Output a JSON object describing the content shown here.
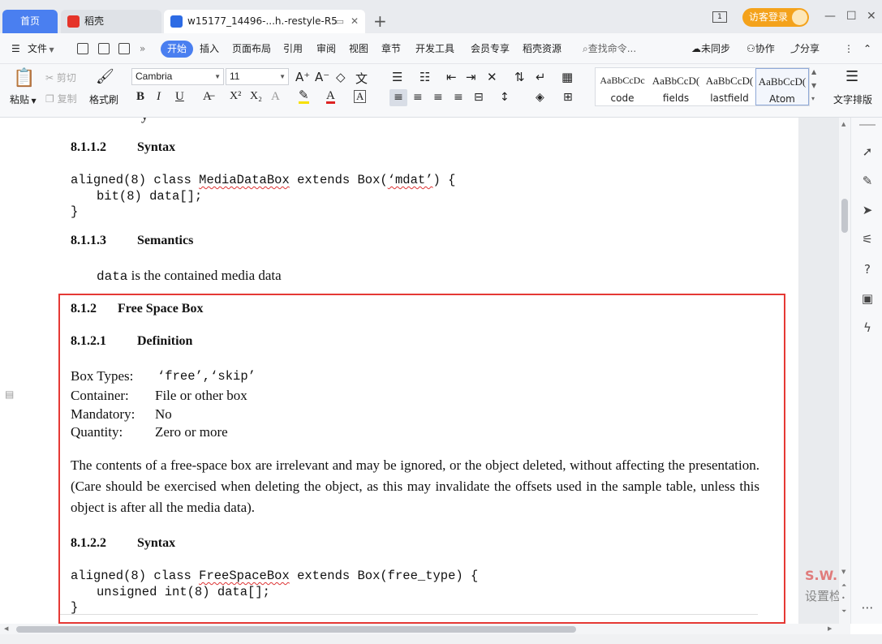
{
  "tabs": {
    "home": "首页",
    "wps": "稻壳",
    "doc": "w15177_14496-...h.-restyle-R5"
  },
  "header": {
    "visitor_login": "访客登录",
    "page_count_icon": "1"
  },
  "menu": {
    "file": "文件",
    "items": [
      "开始",
      "插入",
      "页面布局",
      "引用",
      "审阅",
      "视图",
      "章节",
      "开发工具",
      "会员专享",
      "稻壳资源"
    ],
    "search": "查找命令...",
    "unsync": "未同步",
    "collab": "协作",
    "share": "分享"
  },
  "ribbon": {
    "paste": "粘贴",
    "cut": "剪切",
    "copy": "复制",
    "format_painter": "格式刷",
    "font_name": "Cambria",
    "font_size": "11",
    "text_layout": "文字排版",
    "styles": [
      {
        "sample": "AaBbCcDc",
        "name": "code"
      },
      {
        "sample": "AaBbCcD(",
        "name": "fields"
      },
      {
        "sample": "AaBbCcD(",
        "name": "lastfield"
      },
      {
        "sample": "AaBbCcD(",
        "name": "Atom"
      }
    ]
  },
  "document": {
    "h_8112": {
      "num": "8.1.1.2",
      "title": "Syntax"
    },
    "code1": {
      "line1a": "aligned(8) class ",
      "line1b": "MediaDataBox",
      "line1c": " extends Box(",
      "line1d": "‘mdat’",
      "line1e": ") {",
      "line2": "bit(8) data[];",
      "line3": "}"
    },
    "h_8113": {
      "num": "8.1.1.3",
      "title": "Semantics"
    },
    "semantics": {
      "code": "data",
      "text": " is the contained media data"
    },
    "h_812": {
      "num": "8.1.2",
      "title": "Free Space Box"
    },
    "h_8121": {
      "num": "8.1.2.1",
      "title": "Definition"
    },
    "def": {
      "box_types_label": "Box Types:",
      "box_types_value": "‘free’,‘skip’",
      "container_label": "Container:",
      "container_value": "File or other box",
      "mandatory_label": "Mandatory:",
      "mandatory_value": "No",
      "quantity_label": "Quantity:",
      "quantity_value": "Zero or more"
    },
    "paragraph": "The contents of a free-space box are irrelevant and may be ignored, or the object deleted, without affecting the presentation. (Care should be exercised when deleting the object, as this may invalidate the offsets used in the sample table, unless this object is after all the media data).",
    "h_8122": {
      "num": "8.1.2.2",
      "title": "Syntax"
    },
    "code2": {
      "line1a": "aligned(8) class ",
      "line1b": "FreeSpaceBox",
      "line1c": " extends Box(free_type) {",
      "line2": "unsigned int(8) data[];",
      "line3": "}"
    }
  },
  "watermark": {
    "line1": "S.W.",
    "line2": "设置检"
  },
  "colors": {
    "accent": "#4a7ff0",
    "highlight_box": "#e53935",
    "visitor": "#f4a21b"
  }
}
